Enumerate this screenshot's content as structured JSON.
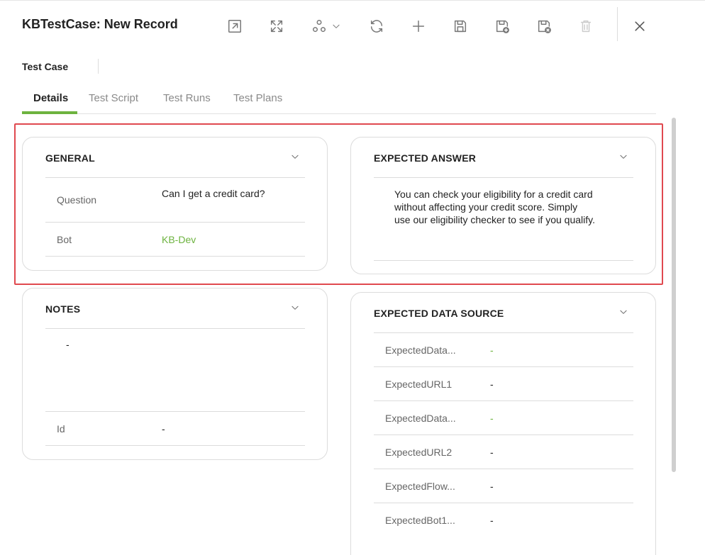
{
  "header": {
    "title": "KBTestCase: New Record",
    "toolbar": [
      {
        "name": "open-in-new-window-button",
        "icon": "open-external-icon"
      },
      {
        "name": "expand-button",
        "icon": "expand-arrows-icon"
      },
      {
        "name": "workflow-menu-button",
        "icon": "workflow-icon"
      },
      {
        "name": "refresh-button",
        "icon": "refresh-icon"
      },
      {
        "name": "add-button",
        "icon": "plus-icon"
      },
      {
        "name": "save-button",
        "icon": "save-icon"
      },
      {
        "name": "save-and-new-button",
        "icon": "save-plus-icon"
      },
      {
        "name": "save-and-close-button",
        "icon": "save-close-icon"
      },
      {
        "name": "delete-button",
        "icon": "trash-icon"
      }
    ],
    "close_icon": "close-icon"
  },
  "form": {
    "label": "Test Case"
  },
  "tabs": [
    {
      "label": "Details",
      "active": true
    },
    {
      "label": "Test Script",
      "active": false
    },
    {
      "label": "Test Runs",
      "active": false
    },
    {
      "label": "Test Plans",
      "active": false
    }
  ],
  "general": {
    "title": "GENERAL",
    "fields": [
      {
        "label": "Question",
        "value": "Can I get a credit card?"
      },
      {
        "label": "Bot",
        "value": "KB-Dev"
      }
    ]
  },
  "expected_answer": {
    "title": "EXPECTED ANSWER",
    "lines": [
      "You can check your eligibility for a credit card",
      "without affecting your credit score. Simply",
      "use our eligibility checker to see if you qualify."
    ]
  },
  "notes": {
    "title": "NOTES",
    "value": "-",
    "fields": [
      {
        "label": "Id",
        "value": "-"
      }
    ]
  },
  "expected_data_source": {
    "title": "EXPECTED DATA SOURCE",
    "fields": [
      {
        "label": "ExpectedData...",
        "value": "-"
      },
      {
        "label": "ExpectedURL1",
        "value": "-"
      },
      {
        "label": "ExpectedData...",
        "value": "-"
      },
      {
        "label": "ExpectedURL2",
        "value": "-"
      },
      {
        "label": "ExpectedFlow...",
        "value": "-"
      },
      {
        "label": "ExpectedBot1...",
        "value": "-"
      }
    ]
  },
  "colors": {
    "accent": "#6db33f",
    "highlight": "#e0494f"
  }
}
